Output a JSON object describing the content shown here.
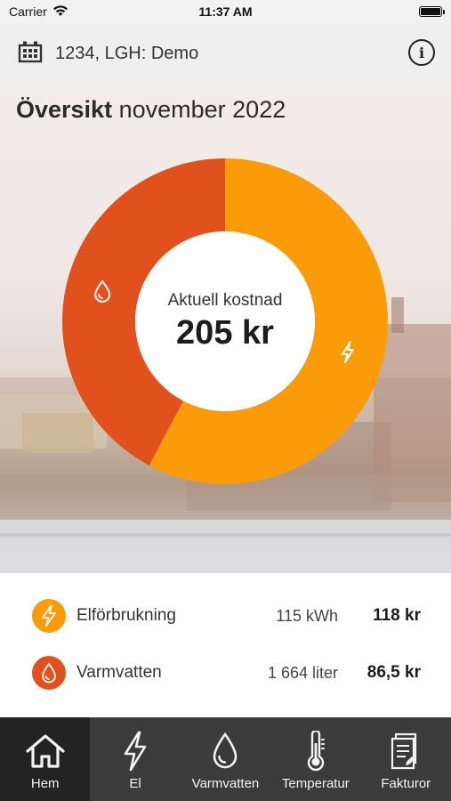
{
  "status_bar": {
    "carrier": "Carrier",
    "time": "11:37 AM"
  },
  "header": {
    "icon": "building-icon",
    "title": "1234, LGH: Demo",
    "info_icon": "info-icon",
    "info_glyph": "i"
  },
  "overview": {
    "title_bold": "Översikt",
    "title_rest": "november 2022"
  },
  "donut": {
    "center_label": "Aktuell kostnad",
    "center_value": "205 kr",
    "segments": [
      {
        "name": "Elförbrukning",
        "value": 118,
        "color": "#fa9b0a",
        "icon": "lightning-icon"
      },
      {
        "name": "Varmvatten",
        "value": 86.5,
        "color": "#e1511e",
        "icon": "water-drop-icon"
      }
    ]
  },
  "consumption": [
    {
      "label": "Elförbrukning",
      "amount": "115 kWh",
      "cost": "118 kr",
      "icon": "lightning-icon",
      "color": "#fa9b0a"
    },
    {
      "label": "Varmvatten",
      "amount": "1 664 liter",
      "cost": "86,5 kr",
      "icon": "water-drop-icon",
      "color": "#e1511e"
    }
  ],
  "tabs": [
    {
      "label": "Hem",
      "icon": "home-icon",
      "active": true
    },
    {
      "label": "El",
      "icon": "lightning-icon",
      "active": false
    },
    {
      "label": "Varmvatten",
      "icon": "water-drop-icon",
      "active": false
    },
    {
      "label": "Temperatur",
      "icon": "thermometer-icon",
      "active": false
    },
    {
      "label": "Fakturor",
      "icon": "invoice-icon",
      "active": false
    }
  ]
}
